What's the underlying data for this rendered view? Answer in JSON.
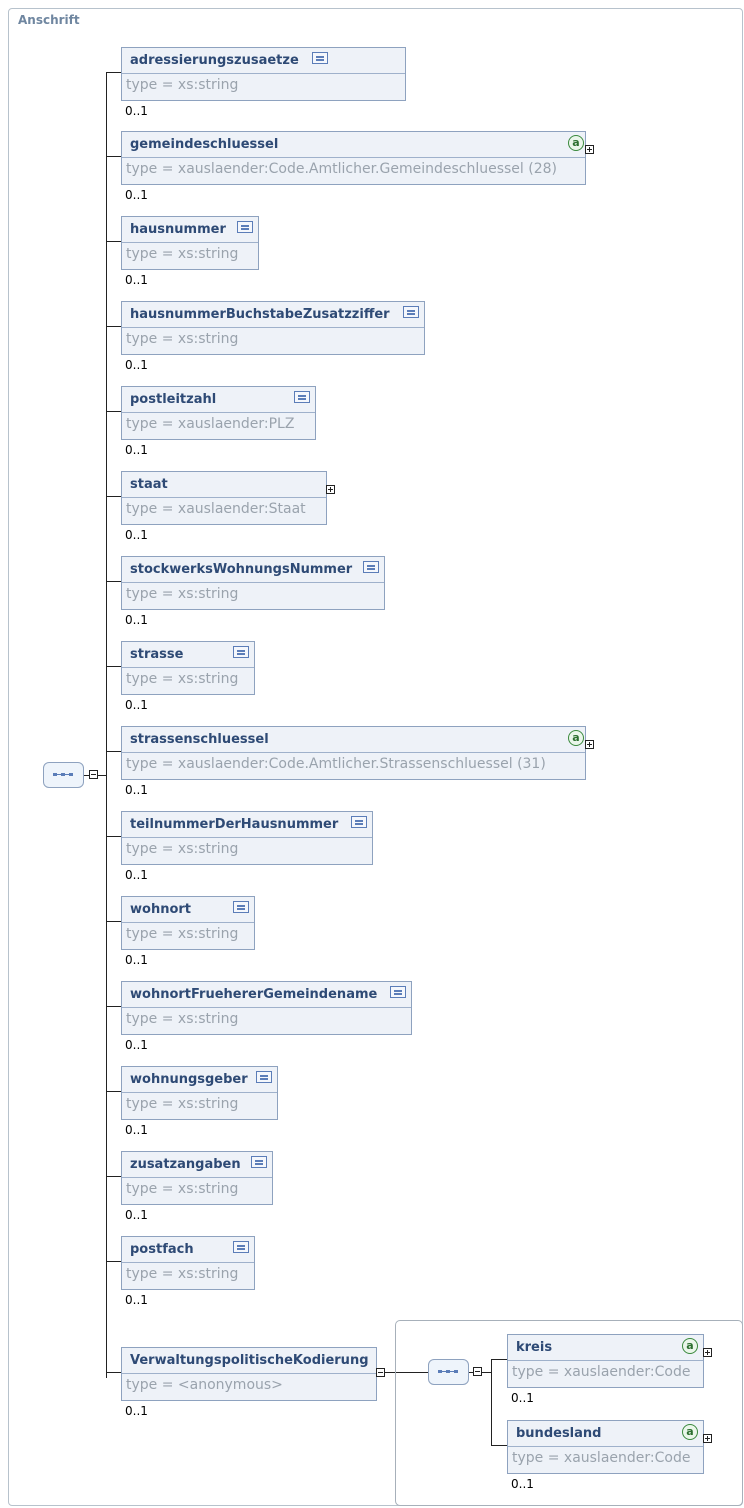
{
  "diagram_title": "Anschrift",
  "elements": [
    {
      "name": "adressierungszusaetze",
      "type": "type = xs:string",
      "cardinality": "0..1",
      "icon": "simple-type-icon"
    },
    {
      "name": "gemeindeschluessel",
      "type": "type = xauslaender:Code.Amtlicher.Gemeindeschluessel (28)",
      "cardinality": "0..1",
      "icon": "attribute-icon"
    },
    {
      "name": "hausnummer",
      "type": "type = xs:string",
      "cardinality": "0..1",
      "icon": "simple-type-icon"
    },
    {
      "name": "hausnummerBuchstabeZusatzziffer",
      "type": "type = xs:string",
      "cardinality": "0..1",
      "icon": "simple-type-icon"
    },
    {
      "name": "postleitzahl",
      "type": "type = xauslaender:PLZ",
      "cardinality": "0..1",
      "icon": "simple-type-icon"
    },
    {
      "name": "staat",
      "type": "type = xauslaender:Staat",
      "cardinality": "0..1",
      "icon": ""
    },
    {
      "name": "stockwerksWohnungsNummer",
      "type": "type = xs:string",
      "cardinality": "0..1",
      "icon": "simple-type-icon"
    },
    {
      "name": "strasse",
      "type": "type = xs:string",
      "cardinality": "0..1",
      "icon": "simple-type-icon"
    },
    {
      "name": "strassenschluessel",
      "type": "type = xauslaender:Code.Amtlicher.Strassenschluessel (31)",
      "cardinality": "0..1",
      "icon": "attribute-icon"
    },
    {
      "name": "teilnummerDerHausnummer",
      "type": "type = xs:string",
      "cardinality": "0..1",
      "icon": "simple-type-icon"
    },
    {
      "name": "wohnort",
      "type": "type = xs:string",
      "cardinality": "0..1",
      "icon": "simple-type-icon"
    },
    {
      "name": "wohnortFruehererGemeindename",
      "type": "type = xs:string",
      "cardinality": "0..1",
      "icon": "simple-type-icon"
    },
    {
      "name": "wohnungsgeber",
      "type": "type = xs:string",
      "cardinality": "0..1",
      "icon": "simple-type-icon"
    },
    {
      "name": "zusatzangaben",
      "type": "type = xs:string",
      "cardinality": "0..1",
      "icon": "simple-type-icon"
    },
    {
      "name": "postfach",
      "type": "type = xs:string",
      "cardinality": "0..1",
      "icon": "simple-type-icon"
    },
    {
      "name": "VerwaltungspolitischeKodierung",
      "type": "type = <anonymous>",
      "cardinality": "0..1",
      "icon": ""
    }
  ],
  "nested_elements": [
    {
      "name": "kreis",
      "type": "type = xauslaender:Code",
      "cardinality": "0..1",
      "icon": "attribute-icon"
    },
    {
      "name": "bundesland",
      "type": "type = xauslaender:Code",
      "cardinality": "0..1",
      "icon": "attribute-icon"
    }
  ],
  "colors": {
    "border": "#8ea2bf",
    "box_fill": "#eef2f8",
    "name_text": "#2e4a75",
    "type_text": "#9aa3ad",
    "attribute_icon": "#3b8a3e"
  }
}
